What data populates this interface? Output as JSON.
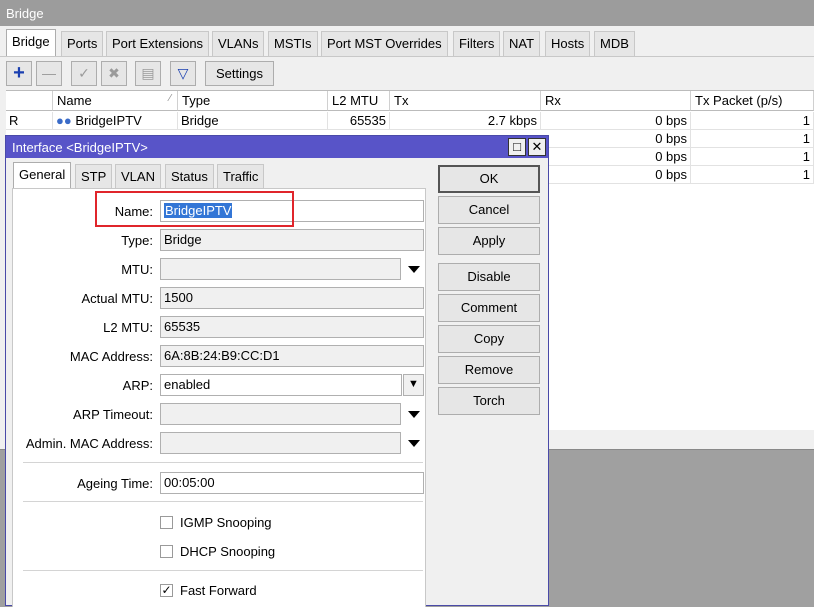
{
  "bridge": {
    "title": "Bridge",
    "tabs": [
      "Bridge",
      "Ports",
      "Port Extensions",
      "VLANs",
      "MSTIs",
      "Port MST Overrides",
      "Filters",
      "NAT",
      "Hosts",
      "MDB"
    ],
    "settings_label": "Settings",
    "toolbar_icons": [
      "add-icon",
      "remove-icon",
      "enable-icon",
      "disable-icon",
      "comment-icon",
      "filter-icon"
    ],
    "columns": [
      "",
      "Name",
      "Type",
      "L2 MTU",
      "Tx",
      "Rx",
      "Tx Packet (p/s)"
    ],
    "rows": [
      {
        "flag": "R",
        "name": "BridgeIPTV",
        "type": "Bridge",
        "l2mtu": "65535",
        "tx": "2.7 kbps",
        "rx": "0 bps",
        "txp": "1"
      },
      {
        "flag": "",
        "name": "",
        "type": "",
        "l2mtu": "",
        "tx": "",
        "rx": "0 bps",
        "txp": "1"
      },
      {
        "flag": "",
        "name": "",
        "type": "",
        "l2mtu": "",
        "tx": "",
        "rx": "0 bps",
        "txp": "1"
      },
      {
        "flag": "",
        "name": "",
        "type": "",
        "l2mtu": "",
        "tx": "",
        "rx": "0 bps",
        "txp": "1"
      }
    ]
  },
  "dialog": {
    "title": "Interface <BridgeIPTV>",
    "tabs": [
      "General",
      "STP",
      "VLAN",
      "Status",
      "Traffic"
    ],
    "fields": {
      "name": {
        "label": "Name:",
        "value": "BridgeIPTV"
      },
      "type": {
        "label": "Type:",
        "value": "Bridge"
      },
      "mtu": {
        "label": "MTU:",
        "value": ""
      },
      "actual_mtu": {
        "label": "Actual MTU:",
        "value": "1500"
      },
      "l2_mtu": {
        "label": "L2 MTU:",
        "value": "65535"
      },
      "mac": {
        "label": "MAC Address:",
        "value": "6A:8B:24:B9:CC:D1"
      },
      "arp": {
        "label": "ARP:",
        "value": "enabled"
      },
      "arp_timeout": {
        "label": "ARP Timeout:",
        "value": ""
      },
      "admin_mac": {
        "label": "Admin. MAC Address:",
        "value": ""
      },
      "ageing": {
        "label": "Ageing Time:",
        "value": "00:05:00"
      }
    },
    "checkboxes": {
      "igmp": {
        "label": "IGMP Snooping",
        "checked": false
      },
      "dhcp": {
        "label": "DHCP Snooping",
        "checked": false
      },
      "fast_forward": {
        "label": "Fast Forward",
        "checked": true
      }
    },
    "buttons": [
      "OK",
      "Cancel",
      "Apply",
      "Disable",
      "Comment",
      "Copy",
      "Remove",
      "Torch"
    ]
  }
}
